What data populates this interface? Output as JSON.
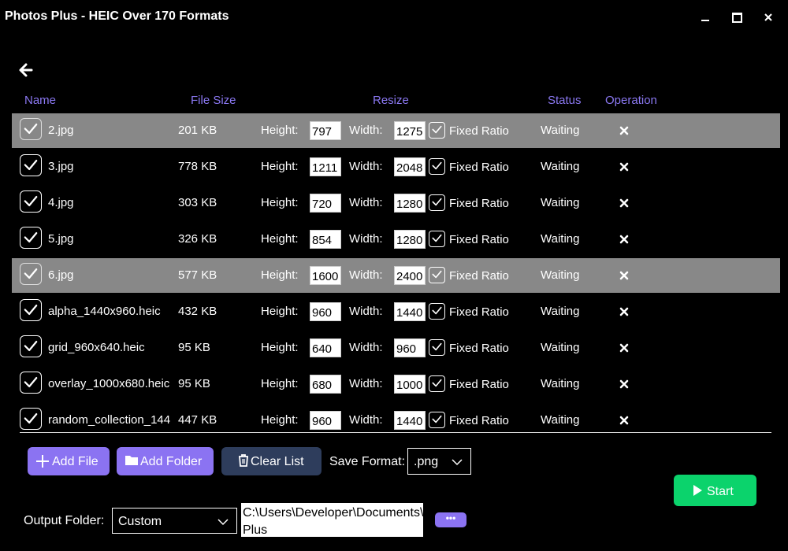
{
  "window": {
    "title": "Photos Plus - HEIC Over 170 Formats"
  },
  "columns": {
    "name": "Name",
    "file_size": "File Size",
    "resize": "Resize",
    "status": "Status",
    "operation": "Operation"
  },
  "row_labels": {
    "height": "Height:",
    "width": "Width:",
    "fixed_ratio": "Fixed Ratio"
  },
  "files": [
    {
      "name": "2.jpg",
      "size": "201 KB",
      "height": "797",
      "width": "1275",
      "status": "Waiting",
      "selected": true
    },
    {
      "name": "3.jpg",
      "size": "778 KB",
      "height": "1211",
      "width": "2048",
      "status": "Waiting",
      "selected": false
    },
    {
      "name": "4.jpg",
      "size": "303 KB",
      "height": "720",
      "width": "1280",
      "status": "Waiting",
      "selected": false
    },
    {
      "name": "5.jpg",
      "size": "326 KB",
      "height": "854",
      "width": "1280",
      "status": "Waiting",
      "selected": false
    },
    {
      "name": "6.jpg",
      "size": "577 KB",
      "height": "1600",
      "width": "2400",
      "status": "Waiting",
      "selected": true
    },
    {
      "name": "alpha_1440x960.heic",
      "size": "432 KB",
      "height": "960",
      "width": "1440",
      "status": "Waiting",
      "selected": false
    },
    {
      "name": "grid_960x640.heic",
      "size": "95 KB",
      "height": "640",
      "width": "960",
      "status": "Waiting",
      "selected": false
    },
    {
      "name": "overlay_1000x680.heic",
      "size": "95 KB",
      "height": "680",
      "width": "1000",
      "status": "Waiting",
      "selected": false
    },
    {
      "name": "random_collection_144",
      "size": "447 KB",
      "height": "960",
      "width": "1440",
      "status": "Waiting",
      "selected": false
    }
  ],
  "toolbar": {
    "add_file": "Add File",
    "add_folder": "Add Folder",
    "clear_list": "Clear List",
    "save_format_label": "Save Format:",
    "save_format_value": ".png",
    "start": "Start"
  },
  "output": {
    "label": "Output Folder:",
    "mode": "Custom",
    "path": "C:\\Users\\Developer\\Documents\\HEIC Plus",
    "browse": "•••"
  },
  "colors": {
    "accent": "#8b73f2",
    "start": "#0bd36c",
    "clear": "#2e3d5c",
    "selected_row": "#888888"
  }
}
